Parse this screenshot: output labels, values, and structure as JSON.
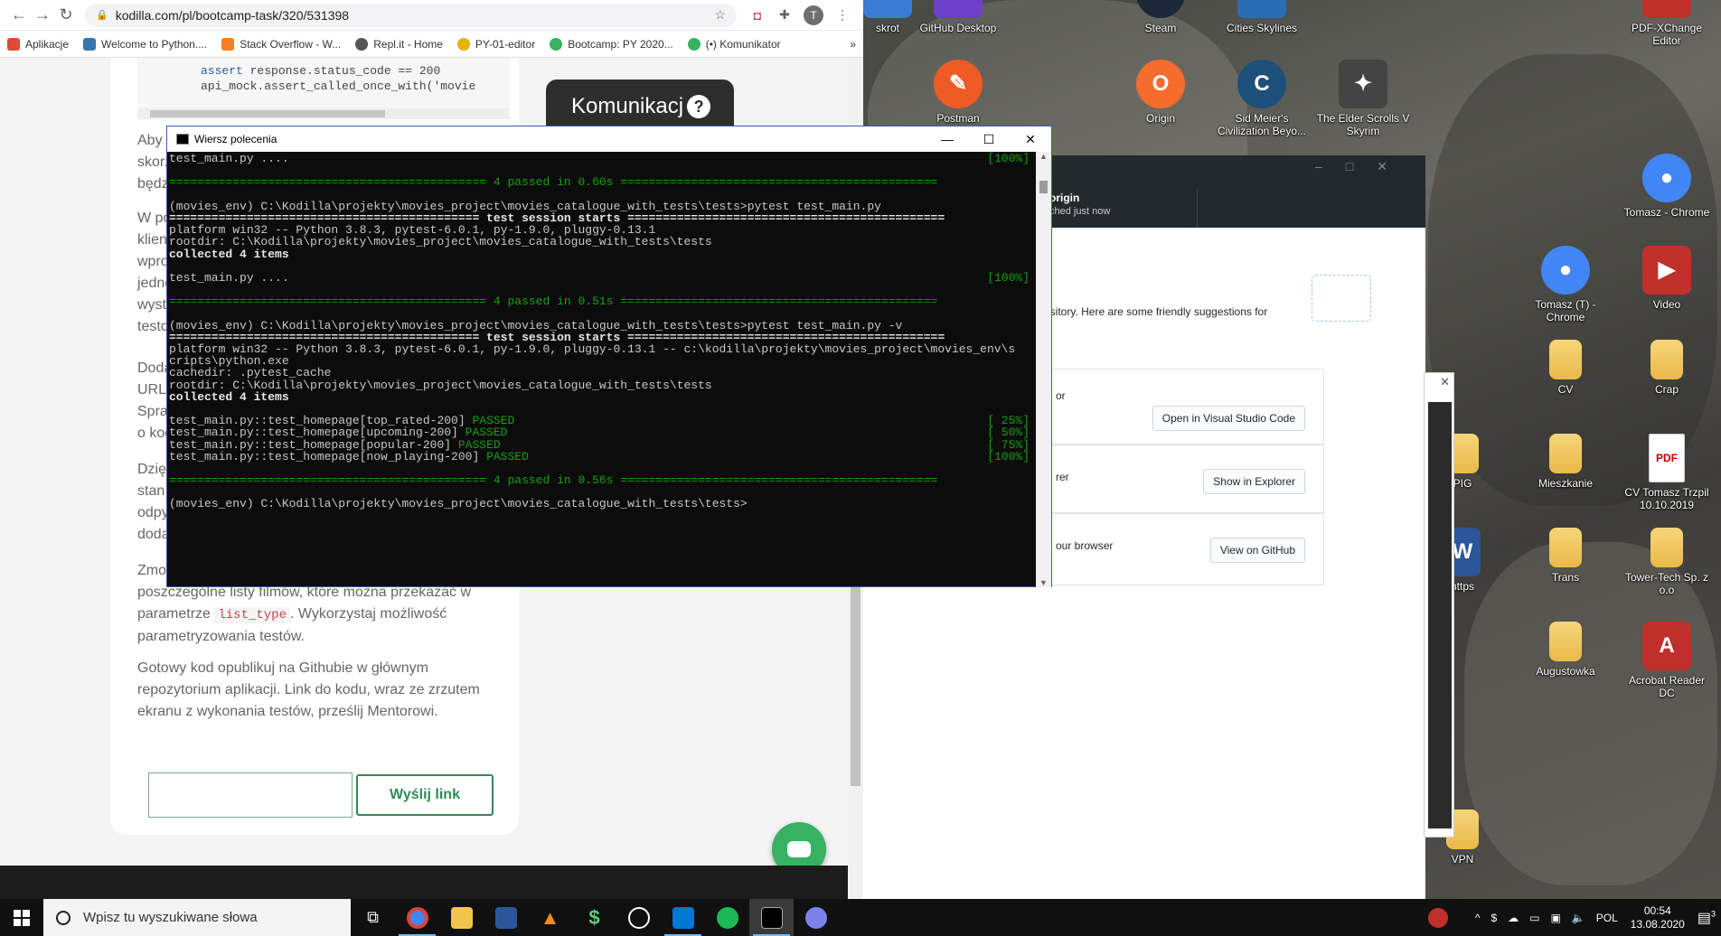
{
  "browser": {
    "url": "kodilla.com/pl/bootcamp-task/320/531398",
    "avatar_letter": "T",
    "bookmarks": [
      {
        "label": "Aplikacje",
        "color": "#e04a3a"
      },
      {
        "label": "Welcome to Python....",
        "color": "#3776ab"
      },
      {
        "label": "Stack Overflow - W...",
        "color": "#f48024"
      },
      {
        "label": "Repl.it - Home",
        "color": "#555555"
      },
      {
        "label": "PY-01-editor",
        "color": "#e3b505"
      },
      {
        "label": "Bootcamp: PY 2020...",
        "color": "#37b162"
      },
      {
        "label": "(•) Komunikator",
        "color": "#37b162"
      }
    ],
    "more_bookmarks": "»",
    "code_lines": [
      "assert response.status_code == 200",
      "api_mock.assert_called_once_with('movie"
    ],
    "para_fragments": [
      [
        "Aby r",
        "skorz",
        "będz"
      ],
      [
        "W po",
        "klien",
        "wpro",
        "jedno",
        "wyst",
        "testo"
      ],
      [
        "Doda",
        "URL",
        "Spra",
        "o kod"
      ],
      [
        "Dzię",
        "stan",
        "odpy",
        "doda"
      ]
    ],
    "para5_line1": "Zmo",
    "para5_line2": "poszczególne listy filmów, które można przekazać w",
    "para5_line3a": "parametrze ",
    "para5_code": "list_type",
    "para5_line3b": ". Wykorzystaj możliwość",
    "para5_line4": "parametryzowania testów.",
    "para6": "Gotowy kod opublikuj na Githubie w głównym repozytorium aplikacji. Link do kodu, wraz ze zrzutem ekranu z wykonania testów, prześlij Mentorowi.",
    "link_input_value": "",
    "send_button": "Wyślij link",
    "komunikator": "Komunikacj",
    "komunikator_q": "?"
  },
  "cmd": {
    "title": "Wiersz polecenia",
    "lines": [
      {
        "text": "test_main.py ....",
        "right": "[100%]",
        "style": "",
        "dots": true
      },
      {
        "text": "",
        "right": "",
        "style": ""
      },
      {
        "text": "============================================= 4 passed in 0.60s =============================================",
        "right": "",
        "style": "g"
      },
      {
        "text": "",
        "right": "",
        "style": ""
      },
      {
        "text": "(movies_env) C:\\Kodilla\\projekty\\movies_project\\movies_catalogue_with_tests\\tests>pytest test_main.py",
        "right": "",
        "style": ""
      },
      {
        "text": "============================================ test session starts =============================================",
        "right": "",
        "style": "w"
      },
      {
        "text": "platform win32 -- Python 3.8.3, pytest-6.0.1, py-1.9.0, pluggy-0.13.1",
        "right": "",
        "style": ""
      },
      {
        "text": "rootdir: C:\\Kodilla\\projekty\\movies_project\\movies_catalogue_with_tests\\tests",
        "right": "",
        "style": ""
      },
      {
        "text": "collected 4 items",
        "right": "",
        "style": "w"
      },
      {
        "text": "",
        "right": "",
        "style": ""
      },
      {
        "text": "test_main.py ....",
        "right": "[100%]",
        "style": "",
        "dots": true
      },
      {
        "text": "",
        "right": "",
        "style": ""
      },
      {
        "text": "============================================= 4 passed in 0.51s =============================================",
        "right": "",
        "style": "g"
      },
      {
        "text": "",
        "right": "",
        "style": ""
      },
      {
        "text": "(movies_env) C:\\Kodilla\\projekty\\movies_project\\movies_catalogue_with_tests\\tests>pytest test_main.py -v",
        "right": "",
        "style": ""
      },
      {
        "text": "============================================ test session starts =============================================",
        "right": "",
        "style": "w"
      },
      {
        "text": "platform win32 -- Python 3.8.3, pytest-6.0.1, py-1.9.0, pluggy-0.13.1 -- c:\\kodilla\\projekty\\movies_project\\movies_env\\s",
        "right": "",
        "style": ""
      },
      {
        "text": "cripts\\python.exe",
        "right": "",
        "style": ""
      },
      {
        "text": "cachedir: .pytest_cache",
        "right": "",
        "style": ""
      },
      {
        "text": "rootdir: C:\\Kodilla\\projekty\\movies_project\\movies_catalogue_with_tests\\tests",
        "right": "",
        "style": ""
      },
      {
        "text": "collected 4 items",
        "right": "",
        "style": "w"
      },
      {
        "text": "",
        "right": "",
        "style": ""
      },
      {
        "text": "test_main.py::test_homepage[top_rated-200] ",
        "pass": "PASSED",
        "right": "[ 25%]",
        "style": ""
      },
      {
        "text": "test_main.py::test_homepage[upcoming-200] ",
        "pass": "PASSED",
        "right": "[ 50%]",
        "style": ""
      },
      {
        "text": "test_main.py::test_homepage[popular-200] ",
        "pass": "PASSED",
        "right": "[ 75%]",
        "style": ""
      },
      {
        "text": "test_main.py::test_homepage[now_playing-200] ",
        "pass": "PASSED",
        "right": "[100%]",
        "style": ""
      },
      {
        "text": "",
        "right": "",
        "style": ""
      },
      {
        "text": "============================================= 4 passed in 0.56s =============================================",
        "right": "",
        "style": "g"
      },
      {
        "text": "",
        "right": "",
        "style": ""
      },
      {
        "text": "(movies_env) C:\\Kodilla\\projekty\\movies_project\\movies_catalogue_with_tests\\tests>",
        "right": "",
        "style": ""
      }
    ]
  },
  "github_desktop": {
    "branch_title": "origin",
    "branch_sub": "ched just now",
    "suggestion_text": "ository. Here are some friendly suggestions for",
    "row1_label": "or",
    "row1_button": "Open in Visual Studio Code",
    "row2_label": "rer",
    "row2_button": "Show in Explorer",
    "row3_label": "our browser",
    "row3_button": "View on GitHub"
  },
  "desktop_icons": [
    {
      "label": "skrot",
      "color": "#3a7bd5"
    },
    {
      "label": "GitHub Desktop",
      "color": "#6e40c9"
    },
    {
      "label": "Steam",
      "color": "#1b2838"
    },
    {
      "label": "Cities Skylines",
      "color": "#2a6db3"
    },
    {
      "label": "PDF-XChange Editor",
      "color": "#c0302b"
    },
    {
      "label": "Postman",
      "color": "#ef5b25"
    },
    {
      "label": "Origin",
      "color": "#f56c2d"
    },
    {
      "label": "Sid Meier's Civilization Beyo...",
      "color": "#1e4f7a"
    },
    {
      "label": "The Elder Scrolls V Skyrim",
      "color": "#444444"
    },
    {
      "label": "Tomasz - Chrome",
      "color": "#4285f4"
    },
    {
      "label": "Tomasz (T) - Chrome",
      "color": "#4285f4"
    },
    {
      "label": "Video",
      "color": "#c0302b"
    },
    {
      "label": "CV",
      "color": "#e9b949"
    },
    {
      "label": "Crap",
      "color": "#e9b949"
    },
    {
      "label": "PIG",
      "color": "#e9b949"
    },
    {
      "label": "Mieszkanie",
      "color": "#e9b949"
    },
    {
      "label": "CV Tomasz Trzpil 10.10.2019",
      "color": "#c0302b"
    },
    {
      "label": "https",
      "color": "#2b579a"
    },
    {
      "label": "Trans",
      "color": "#e9b949"
    },
    {
      "label": "Tower-Tech Sp. z o.o",
      "color": "#e9b949"
    },
    {
      "label": "Augustowka",
      "color": "#e9b949"
    },
    {
      "label": "Acrobat Reader DC",
      "color": "#c0302b"
    },
    {
      "label": "VPN",
      "color": "#e9b949"
    }
  ],
  "taskbar": {
    "search_placeholder": "Wpisz tu wyszukiwane słowa",
    "language": "POL",
    "time": "00:54",
    "date": "13.08.2020",
    "notification_count": "3"
  }
}
